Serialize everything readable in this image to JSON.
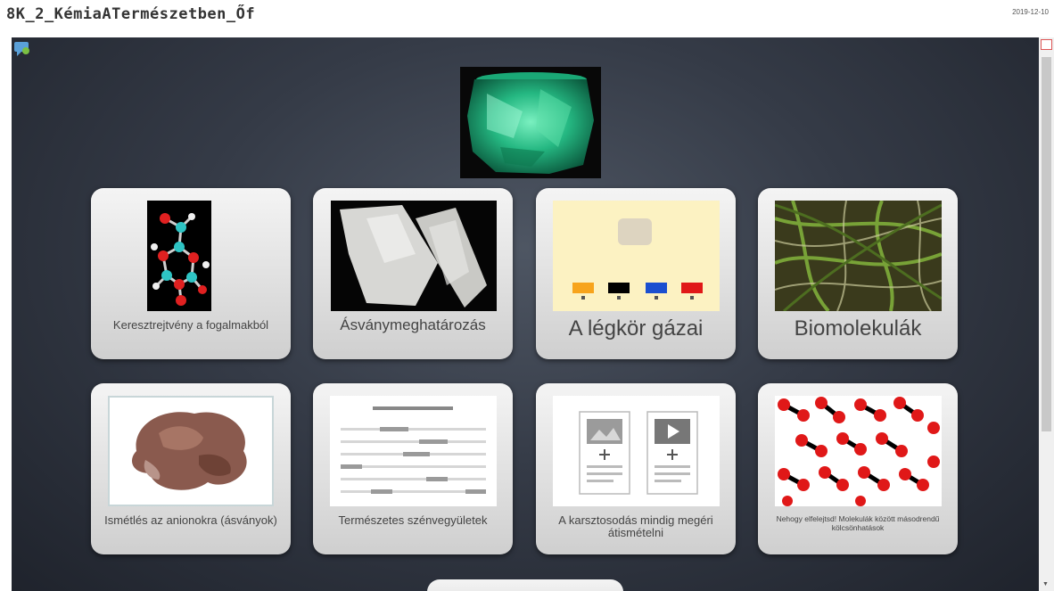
{
  "header": {
    "title": "8K_2_KémiaATermészetben_Őf",
    "date": "2019-12-10"
  },
  "tiles": [
    {
      "label": "Keresztrejtvény a fogalmakból",
      "icon": "molecule-image"
    },
    {
      "label": "Ásványmeghatározás",
      "icon": "crystal-image"
    },
    {
      "label": "A légkör gázai",
      "icon": "gas-cards-image"
    },
    {
      "label": "Biomolekulák",
      "icon": "fibers-image"
    },
    {
      "label": "Ismétlés az anionokra (ásványok)",
      "icon": "mineral-image"
    },
    {
      "label": "Természetes szénvegyületek",
      "icon": "text-lines-image"
    },
    {
      "label": "A karsztosodás mindig megéri átismételni",
      "icon": "media-cards-image"
    },
    {
      "label": "Nehogy elfelejtsd! Molekulák között másodrendű kölcsönhatások",
      "icon": "red-balls-image"
    }
  ],
  "colors": {
    "stage_dark": "#1f232c",
    "tile_bg": "#dedede",
    "emerald": "#2fbf86"
  }
}
